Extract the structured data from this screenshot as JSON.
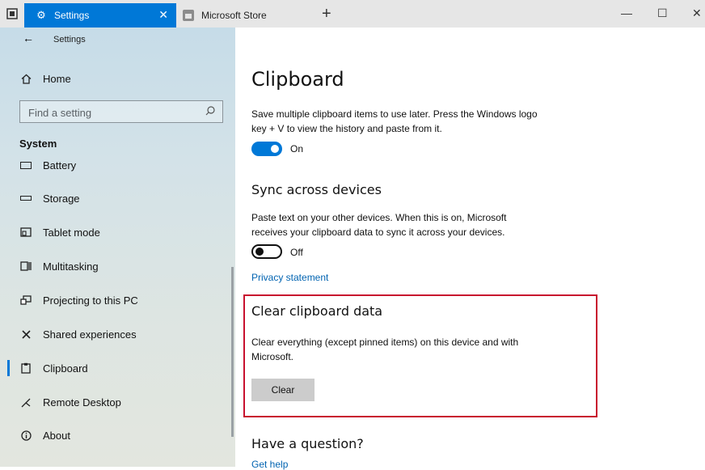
{
  "titlebar": {
    "active_tab": "Settings",
    "inactive_tab": "Microsoft Store",
    "newtab_icon": "plus-icon",
    "close_tab_glyph": "✕",
    "newtab_glyph": "+",
    "minimize_glyph": "—",
    "maximize_glyph": "☐",
    "close_glyph": "✕"
  },
  "sidebar": {
    "back_glyph": "←",
    "title": "Settings",
    "home": "Home",
    "search_placeholder": "Find a setting",
    "section": "System",
    "items": [
      {
        "label": "Battery",
        "icon": "battery-icon"
      },
      {
        "label": "Storage",
        "icon": "storage-icon"
      },
      {
        "label": "Tablet mode",
        "icon": "tablet-mode-icon"
      },
      {
        "label": "Multitasking",
        "icon": "multitasking-icon"
      },
      {
        "label": "Projecting to this PC",
        "icon": "projecting-icon"
      },
      {
        "label": "Shared experiences",
        "icon": "shared-experiences-icon"
      },
      {
        "label": "Clipboard",
        "icon": "clipboard-icon",
        "selected": true
      },
      {
        "label": "Remote Desktop",
        "icon": "remote-desktop-icon"
      },
      {
        "label": "About",
        "icon": "info-icon"
      }
    ]
  },
  "main": {
    "title": "Clipboard",
    "history_desc_1": "Save multiple clipboard items to use later. Press the Windows logo",
    "history_desc_2": "key + V to view the history and paste from it.",
    "history_state": "On",
    "sync_title": "Sync across devices",
    "sync_desc_1": "Paste text on your other devices. When this is on, Microsoft",
    "sync_desc_2": "receives your clipboard data to sync it across your devices.",
    "sync_state": "Off",
    "privacy_link": "Privacy statement",
    "clear_title": "Clear clipboard data",
    "clear_desc_1": "Clear everything (except pinned items) on this device and with",
    "clear_desc_2": "Microsoft.",
    "clear_button": "Clear",
    "question_title": "Have a question?",
    "help_link": "Get help"
  },
  "colors": {
    "accent": "#0078d7",
    "highlight_border": "#c8102e",
    "link": "#0063b1"
  }
}
